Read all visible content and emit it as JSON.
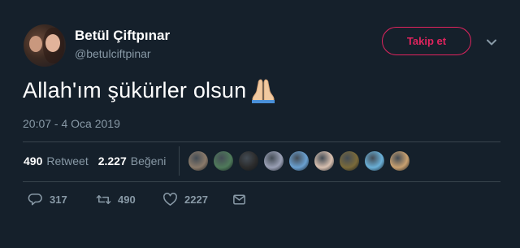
{
  "user": {
    "display_name": "Betül Çiftpınar",
    "handle": "@betulciftpinar",
    "follow_label": "Takip et"
  },
  "tweet": {
    "text": "Allah'ım şükürler olsun",
    "emoji": "folded-hands",
    "timestamp": "20:07 - 4 Oca 2019"
  },
  "stats": {
    "retweet_count": "490",
    "retweet_label": "Retweet",
    "like_count": "2.227",
    "like_label": "Beğeni"
  },
  "liker_avatars": [
    {
      "color": "#8a7a6a"
    },
    {
      "color": "#4f7a5a"
    },
    {
      "color": "#2b2b2b"
    },
    {
      "color": "#9aa0b5"
    },
    {
      "color": "#6aa0d0"
    },
    {
      "color": "#d8c0b0"
    },
    {
      "color": "#7a6a3a"
    },
    {
      "color": "#6ab0d8"
    },
    {
      "color": "#c8a070"
    }
  ],
  "actions": {
    "reply_count": "317",
    "retweet_count": "490",
    "like_count": "2227"
  },
  "colors": {
    "background": "#15202b",
    "muted": "#8899a6",
    "follow_accent": "#e0245e",
    "divider": "#38444d"
  }
}
